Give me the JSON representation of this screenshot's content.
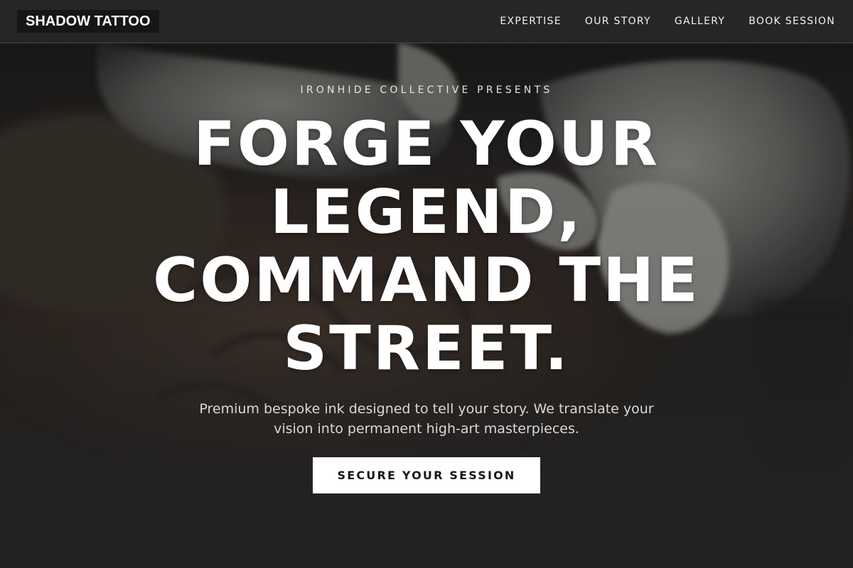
{
  "header": {
    "logo": "SHADOW TATTOO",
    "nav": [
      {
        "label": "EXPERTISE"
      },
      {
        "label": "OUR STORY"
      },
      {
        "label": "GALLERY"
      },
      {
        "label": "BOOK SESSION"
      }
    ]
  },
  "hero": {
    "eyebrow": "IRONHIDE COLLECTIVE PRESENTS",
    "headline_lines": [
      "FORGE YOUR",
      "LEGEND,",
      "COMMAND THE",
      "STREET."
    ],
    "subtext": "Premium bespoke ink designed to tell your story. We translate your vision into permanent high-art masterpieces.",
    "cta_label": "SECURE YOUR SESSION",
    "background_image": "tattoo-artist-gloved-hands-photo"
  },
  "colors": {
    "background": "#232323",
    "header_bg": "#262626",
    "logo_bg": "#161616",
    "text": "#ffffff",
    "subtext": "#d9d9d9",
    "cta_bg": "#ffffff",
    "cta_text": "#161616"
  }
}
